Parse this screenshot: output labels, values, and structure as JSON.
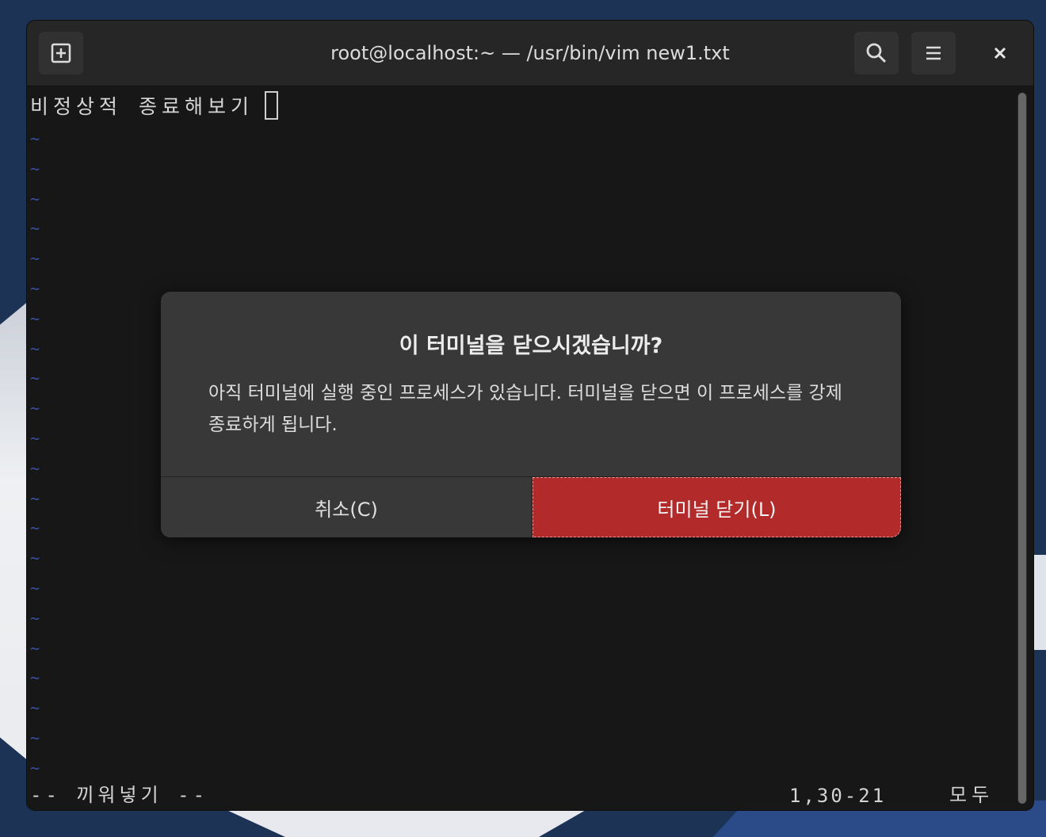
{
  "window": {
    "title": "root@localhost:~ — /usr/bin/vim new1.txt"
  },
  "headerbar": {
    "new_tab_icon": "new-tab-icon",
    "search_icon": "search-icon",
    "menu_icon": "hamburger-menu-icon",
    "close_glyph": "×"
  },
  "terminal": {
    "line1": "비정상적 종료해보기",
    "tilde": "~",
    "status_mode": "-- 끼워넣기 --",
    "status_position": "1,30-21",
    "status_scroll": "모두"
  },
  "dialog": {
    "title": "이 터미널을 닫으시겠습니까?",
    "body": "아직 터미널에 실행 중인 프로세스가 있습니다. 터미널을 닫으면 이 프로세스를 강제 종료하게 됩니다.",
    "cancel_label": "취소(C)",
    "confirm_label": "터미널 닫기(L)"
  },
  "colors": {
    "confirm_button": "#b22a2a",
    "dialog_background": "#383838",
    "terminal_background": "#171717",
    "tilde": "#3a4fa0"
  }
}
